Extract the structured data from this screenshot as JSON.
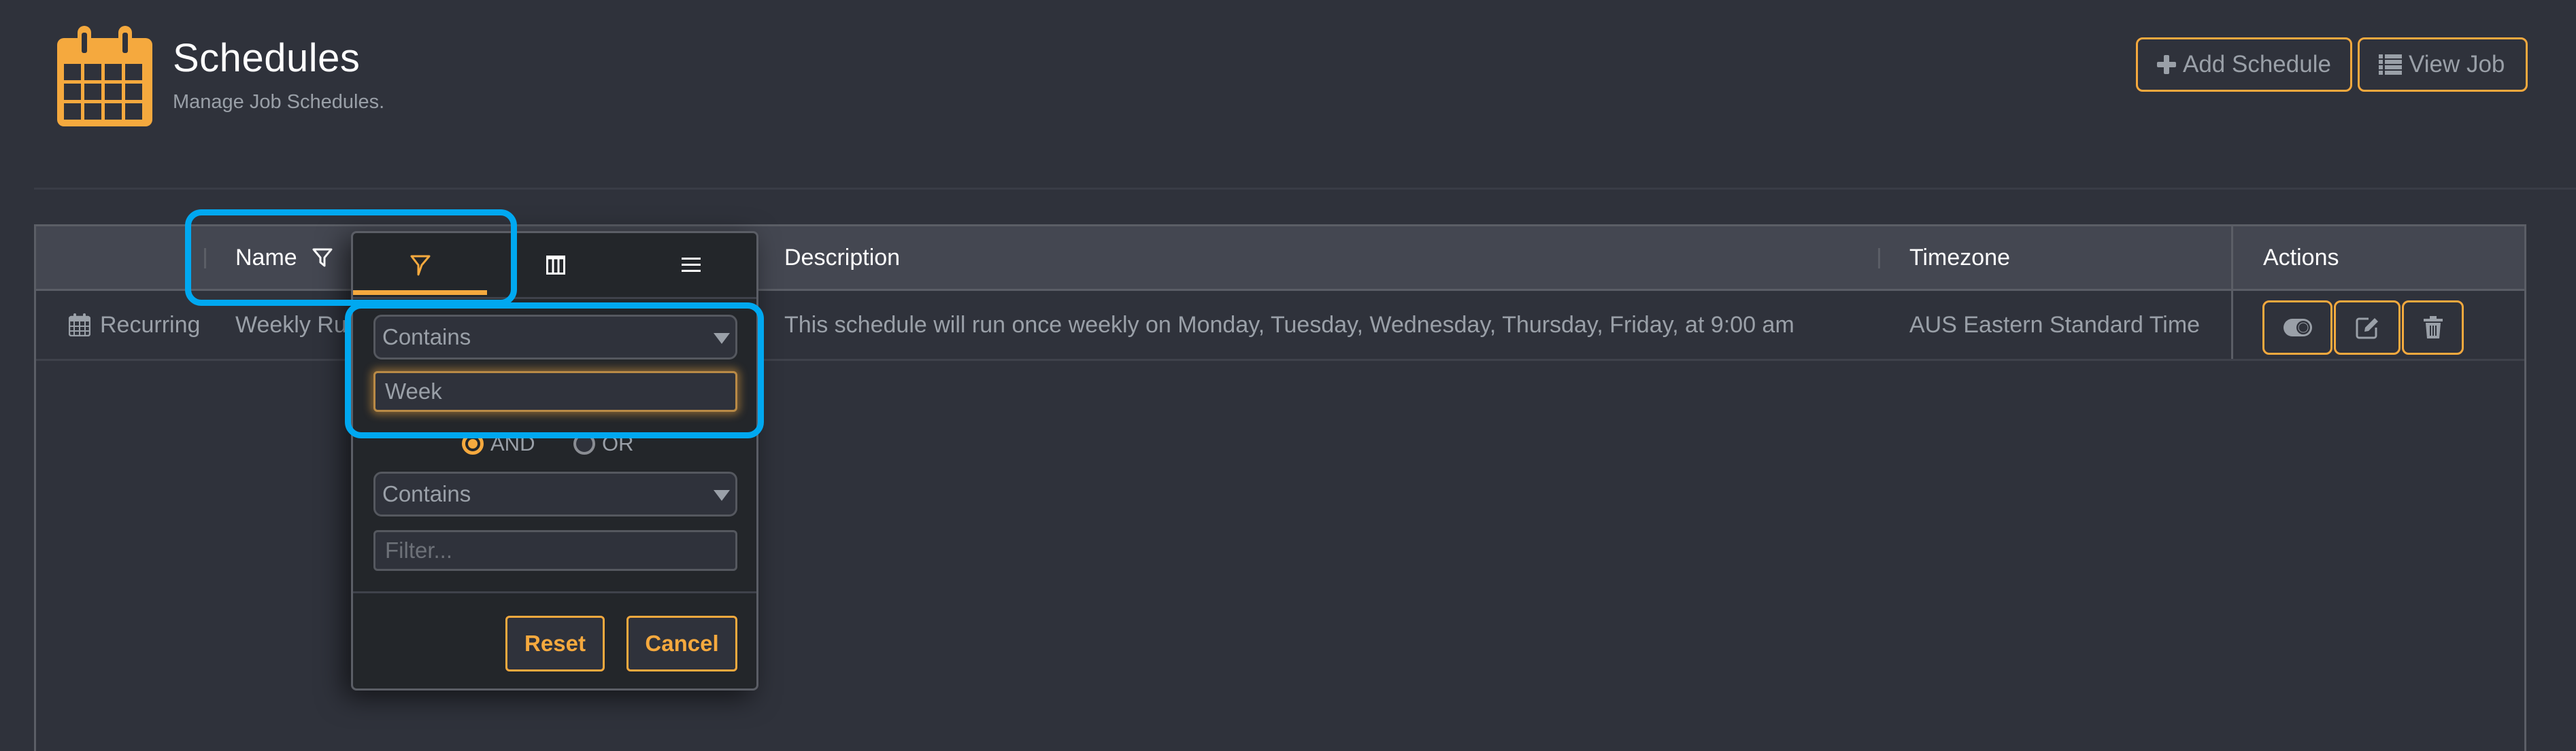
{
  "header": {
    "title": "Schedules",
    "subtitle": "Manage Job Schedules.",
    "logo_icon": "calendar-icon",
    "buttons": {
      "add_schedule": {
        "label": "Add Schedule",
        "icon": "plus-icon"
      },
      "view_job": {
        "label": "View Job",
        "icon": "list-icon"
      }
    }
  },
  "colors": {
    "accent": "#f5a93e",
    "background": "#2f323b",
    "header_row": "#444751",
    "popup": "#23262a",
    "highlight": "#00a8f0",
    "muted_text": "#9aa0a8"
  },
  "table": {
    "columns": [
      {
        "key": "type",
        "label": ""
      },
      {
        "key": "name",
        "label": "Name",
        "icon": "filter-icon"
      },
      {
        "key": "description",
        "label": "Description"
      },
      {
        "key": "timezone",
        "label": "Timezone"
      },
      {
        "key": "actions",
        "label": "Actions"
      }
    ],
    "rows": [
      {
        "type": "Recurring",
        "type_icon": "calendar-icon",
        "name": "Weekly Ru",
        "description": "This schedule will run once weekly on Monday, Tuesday, Wednesday, Thursday, Friday, at 9:00 am",
        "timezone": "AUS Eastern Standard Time",
        "actions": [
          "toggle-icon",
          "edit-icon",
          "trash-icon"
        ]
      }
    ]
  },
  "filter_popup": {
    "tabs": [
      {
        "icon": "filter-icon",
        "active": true
      },
      {
        "icon": "columns-icon",
        "active": false
      },
      {
        "icon": "menu-icon",
        "active": false
      }
    ],
    "condition1": {
      "operator": "Contains",
      "value": "Week"
    },
    "join": {
      "options": [
        "AND",
        "OR"
      ],
      "selected": "AND"
    },
    "condition2": {
      "operator": "Contains",
      "value": "",
      "placeholder": "Filter..."
    },
    "buttons": {
      "reset": "Reset",
      "cancel": "Cancel"
    }
  }
}
